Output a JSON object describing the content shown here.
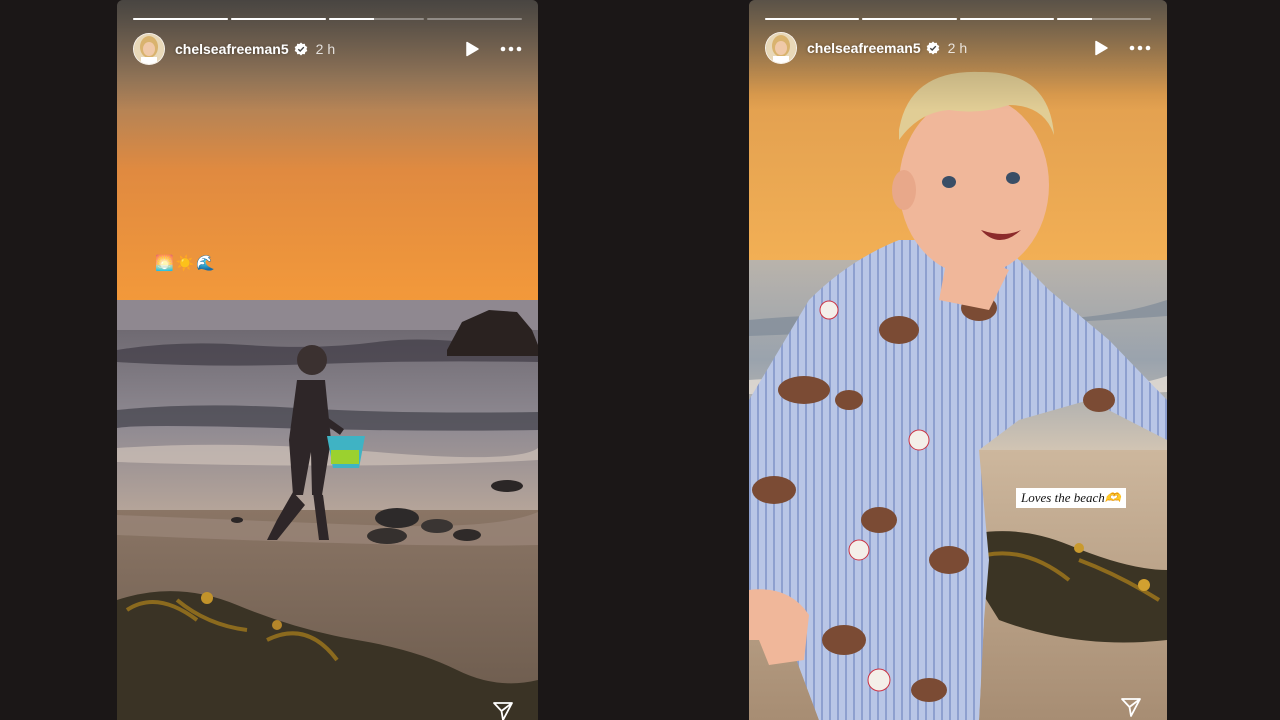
{
  "stories": [
    {
      "username": "chelseafreeman5",
      "time": "2 h",
      "progress": [
        1,
        1,
        0.47,
        0
      ],
      "emoji_sticker": [
        "🌅",
        "☀️",
        "🌊"
      ]
    },
    {
      "username": "chelseafreeman5",
      "time": "2 h",
      "progress": [
        1,
        1,
        1,
        0.37
      ],
      "text_sticker": "Loves the beach🫶"
    }
  ],
  "colors": {
    "background": "#1b1717",
    "progress_fill": "#ffffff",
    "verified": "#ffffff"
  },
  "icons": [
    "verified-badge-icon",
    "play-icon",
    "more-options-icon",
    "share-send-icon"
  ]
}
